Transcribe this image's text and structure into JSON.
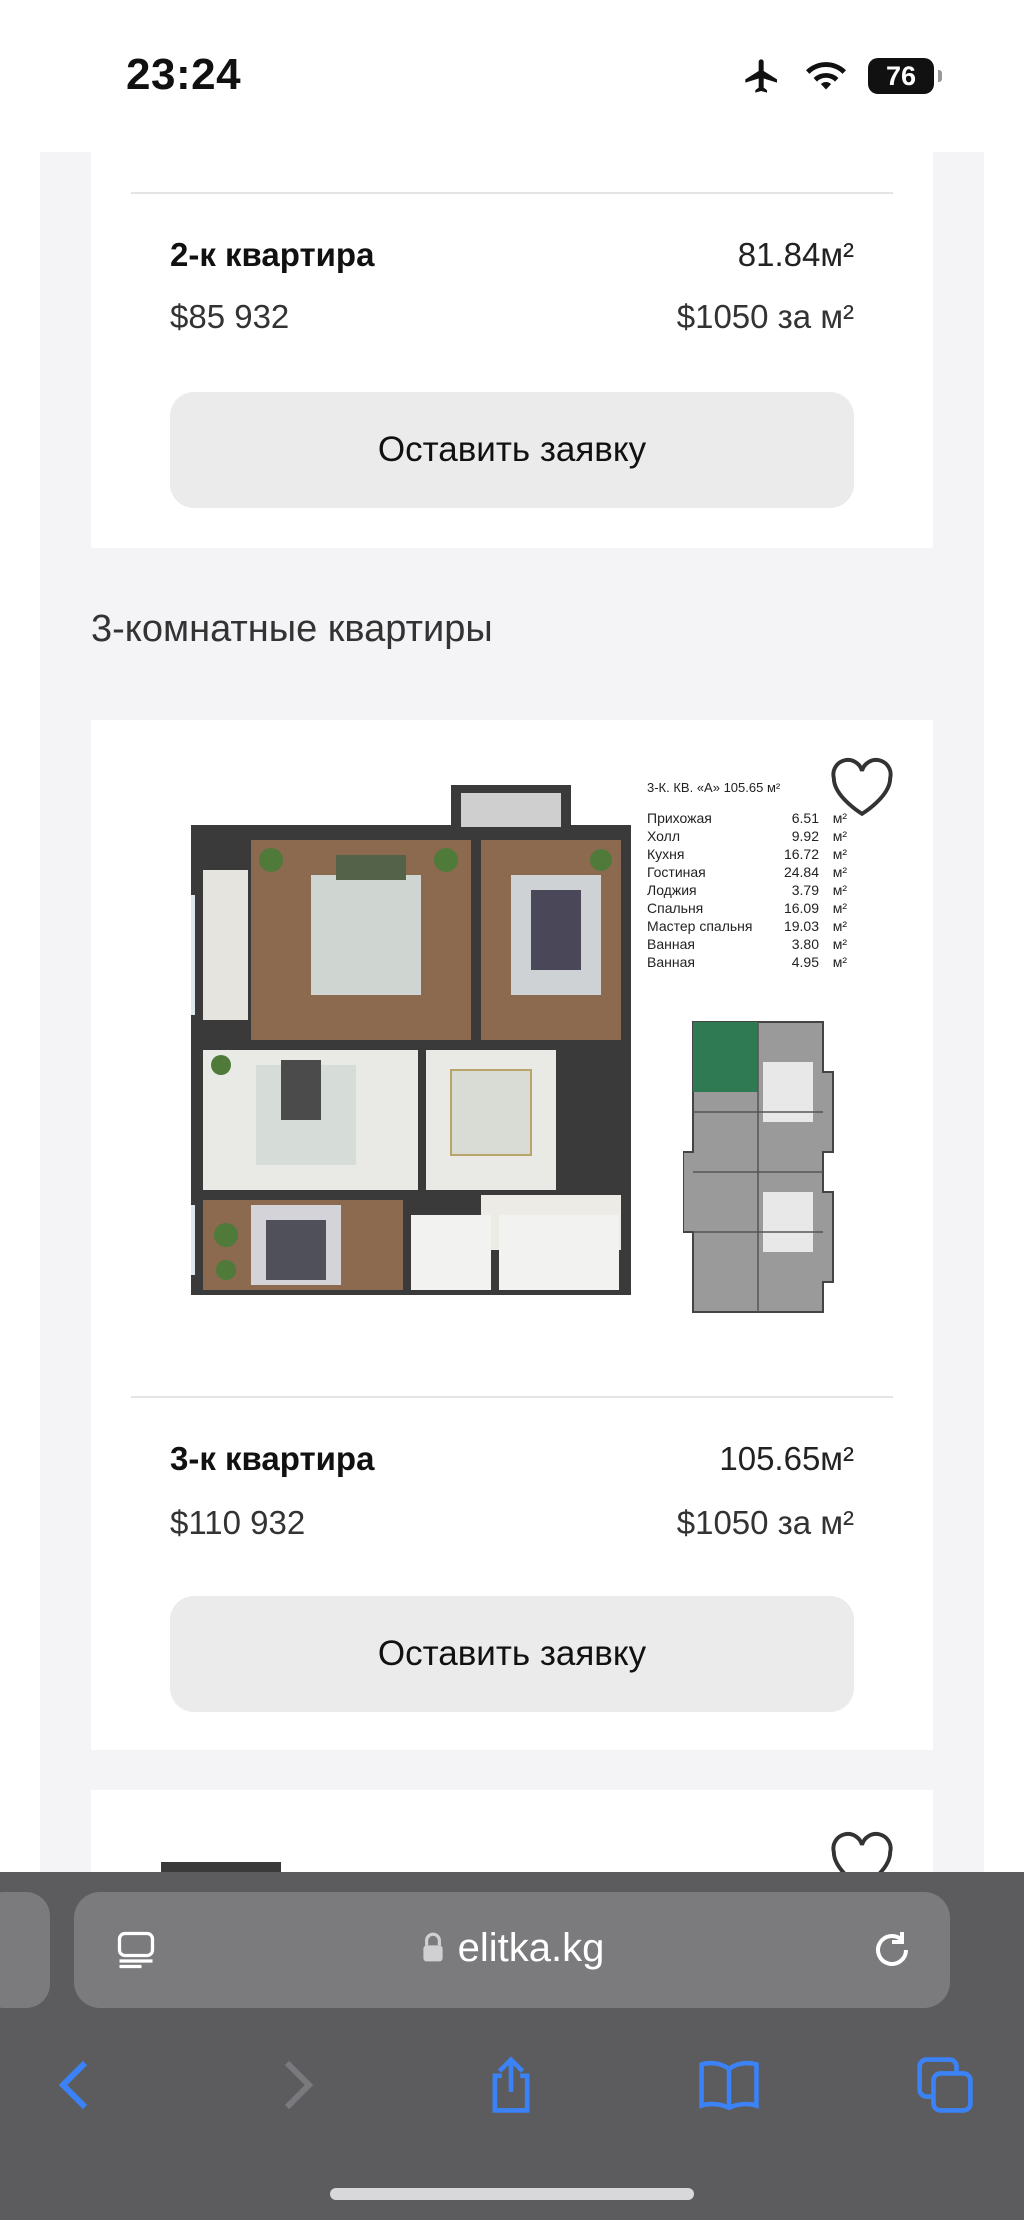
{
  "status": {
    "time": "23:24",
    "battery": "76",
    "icons": [
      "airplane-icon",
      "wifi-icon",
      "battery-icon"
    ]
  },
  "listing_top": {
    "title": "2-к квартира",
    "area": "81.84м²",
    "price": "$85 932",
    "price_per_m2": "$1050 за м²",
    "button": "Оставить заявку"
  },
  "section_title": "3-комнатные квартиры",
  "listing_main": {
    "title": "3-к квартира",
    "area": "105.65м²",
    "price": "$110 932",
    "price_per_m2": "$1050 за м²",
    "button": "Оставить заявку",
    "plan_heading": "3-К. КВ. «А» 105.65 м²",
    "rooms": [
      {
        "name": "Прихожая",
        "area": "6.51"
      },
      {
        "name": "Холл",
        "area": "9.92"
      },
      {
        "name": "Кухня",
        "area": "16.72"
      },
      {
        "name": "Гостиная",
        "area": "24.84"
      },
      {
        "name": "Лоджия",
        "area": "3.79"
      },
      {
        "name": "Спальня",
        "area": "16.09"
      },
      {
        "name": "Мастер спальня",
        "area": "19.03"
      },
      {
        "name": "Ванная",
        "area": "3.80"
      },
      {
        "name": "Ванная",
        "area": "4.95"
      }
    ],
    "unit": "м²",
    "plan_labels": {
      "living": "Гостиная\n24.84м²",
      "bedroom": "Спальня\n16.09м²",
      "kitchen": "Кухня\n16.72м²",
      "hall": "Холл\n9.92м²",
      "loggia": "Лоджия\n3.79м²",
      "master": "Мастер спальня\n19.03м²",
      "entry": "Прихожая\n6.51м²",
      "bath1": "Ванная\n3.80м²",
      "bath2": "Ванная\n4.95м²"
    }
  },
  "browser": {
    "url": "elitka.kg",
    "icons": [
      "reader-icon",
      "lock-icon",
      "reload-icon",
      "back-icon",
      "forward-icon",
      "share-icon",
      "bookmarks-icon",
      "tabs-icon"
    ],
    "accent": "#3b82f6"
  }
}
